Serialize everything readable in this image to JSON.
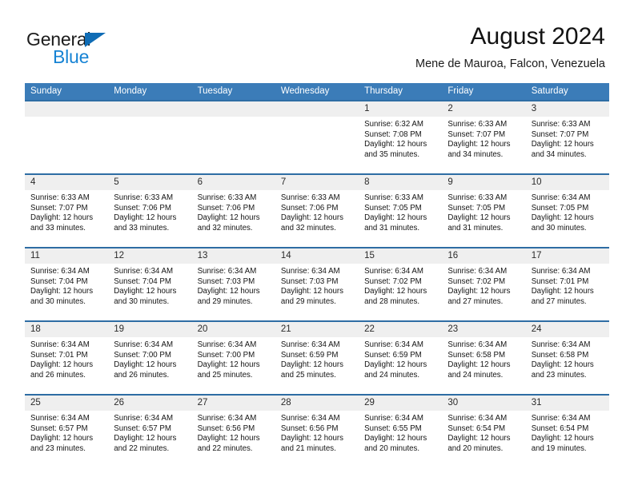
{
  "brand": {
    "name_dark": "General",
    "name_blue": "Blue",
    "accent_color": "#1683d4",
    "triangle_color": "#0f6cb5"
  },
  "header": {
    "title": "August 2024",
    "subtitle": "Mene de Mauroa, Falcon, Venezuela"
  },
  "theme": {
    "header_row_bg": "#3b7cb8",
    "row_separator": "#2e6da4",
    "date_band_bg": "#efefef"
  },
  "weekdays": [
    "Sunday",
    "Monday",
    "Tuesday",
    "Wednesday",
    "Thursday",
    "Friday",
    "Saturday"
  ],
  "weeks": [
    [
      {
        "day": "",
        "empty": true
      },
      {
        "day": "",
        "empty": true
      },
      {
        "day": "",
        "empty": true
      },
      {
        "day": "",
        "empty": true
      },
      {
        "day": "1",
        "sunrise": "Sunrise: 6:32 AM",
        "sunset": "Sunset: 7:08 PM",
        "daylight": "Daylight: 12 hours and 35 minutes."
      },
      {
        "day": "2",
        "sunrise": "Sunrise: 6:33 AM",
        "sunset": "Sunset: 7:07 PM",
        "daylight": "Daylight: 12 hours and 34 minutes."
      },
      {
        "day": "3",
        "sunrise": "Sunrise: 6:33 AM",
        "sunset": "Sunset: 7:07 PM",
        "daylight": "Daylight: 12 hours and 34 minutes."
      }
    ],
    [
      {
        "day": "4",
        "sunrise": "Sunrise: 6:33 AM",
        "sunset": "Sunset: 7:07 PM",
        "daylight": "Daylight: 12 hours and 33 minutes."
      },
      {
        "day": "5",
        "sunrise": "Sunrise: 6:33 AM",
        "sunset": "Sunset: 7:06 PM",
        "daylight": "Daylight: 12 hours and 33 minutes."
      },
      {
        "day": "6",
        "sunrise": "Sunrise: 6:33 AM",
        "sunset": "Sunset: 7:06 PM",
        "daylight": "Daylight: 12 hours and 32 minutes."
      },
      {
        "day": "7",
        "sunrise": "Sunrise: 6:33 AM",
        "sunset": "Sunset: 7:06 PM",
        "daylight": "Daylight: 12 hours and 32 minutes."
      },
      {
        "day": "8",
        "sunrise": "Sunrise: 6:33 AM",
        "sunset": "Sunset: 7:05 PM",
        "daylight": "Daylight: 12 hours and 31 minutes."
      },
      {
        "day": "9",
        "sunrise": "Sunrise: 6:33 AM",
        "sunset": "Sunset: 7:05 PM",
        "daylight": "Daylight: 12 hours and 31 minutes."
      },
      {
        "day": "10",
        "sunrise": "Sunrise: 6:34 AM",
        "sunset": "Sunset: 7:05 PM",
        "daylight": "Daylight: 12 hours and 30 minutes."
      }
    ],
    [
      {
        "day": "11",
        "sunrise": "Sunrise: 6:34 AM",
        "sunset": "Sunset: 7:04 PM",
        "daylight": "Daylight: 12 hours and 30 minutes."
      },
      {
        "day": "12",
        "sunrise": "Sunrise: 6:34 AM",
        "sunset": "Sunset: 7:04 PM",
        "daylight": "Daylight: 12 hours and 30 minutes."
      },
      {
        "day": "13",
        "sunrise": "Sunrise: 6:34 AM",
        "sunset": "Sunset: 7:03 PM",
        "daylight": "Daylight: 12 hours and 29 minutes."
      },
      {
        "day": "14",
        "sunrise": "Sunrise: 6:34 AM",
        "sunset": "Sunset: 7:03 PM",
        "daylight": "Daylight: 12 hours and 29 minutes."
      },
      {
        "day": "15",
        "sunrise": "Sunrise: 6:34 AM",
        "sunset": "Sunset: 7:02 PM",
        "daylight": "Daylight: 12 hours and 28 minutes."
      },
      {
        "day": "16",
        "sunrise": "Sunrise: 6:34 AM",
        "sunset": "Sunset: 7:02 PM",
        "daylight": "Daylight: 12 hours and 27 minutes."
      },
      {
        "day": "17",
        "sunrise": "Sunrise: 6:34 AM",
        "sunset": "Sunset: 7:01 PM",
        "daylight": "Daylight: 12 hours and 27 minutes."
      }
    ],
    [
      {
        "day": "18",
        "sunrise": "Sunrise: 6:34 AM",
        "sunset": "Sunset: 7:01 PM",
        "daylight": "Daylight: 12 hours and 26 minutes."
      },
      {
        "day": "19",
        "sunrise": "Sunrise: 6:34 AM",
        "sunset": "Sunset: 7:00 PM",
        "daylight": "Daylight: 12 hours and 26 minutes."
      },
      {
        "day": "20",
        "sunrise": "Sunrise: 6:34 AM",
        "sunset": "Sunset: 7:00 PM",
        "daylight": "Daylight: 12 hours and 25 minutes."
      },
      {
        "day": "21",
        "sunrise": "Sunrise: 6:34 AM",
        "sunset": "Sunset: 6:59 PM",
        "daylight": "Daylight: 12 hours and 25 minutes."
      },
      {
        "day": "22",
        "sunrise": "Sunrise: 6:34 AM",
        "sunset": "Sunset: 6:59 PM",
        "daylight": "Daylight: 12 hours and 24 minutes."
      },
      {
        "day": "23",
        "sunrise": "Sunrise: 6:34 AM",
        "sunset": "Sunset: 6:58 PM",
        "daylight": "Daylight: 12 hours and 24 minutes."
      },
      {
        "day": "24",
        "sunrise": "Sunrise: 6:34 AM",
        "sunset": "Sunset: 6:58 PM",
        "daylight": "Daylight: 12 hours and 23 minutes."
      }
    ],
    [
      {
        "day": "25",
        "sunrise": "Sunrise: 6:34 AM",
        "sunset": "Sunset: 6:57 PM",
        "daylight": "Daylight: 12 hours and 23 minutes."
      },
      {
        "day": "26",
        "sunrise": "Sunrise: 6:34 AM",
        "sunset": "Sunset: 6:57 PM",
        "daylight": "Daylight: 12 hours and 22 minutes."
      },
      {
        "day": "27",
        "sunrise": "Sunrise: 6:34 AM",
        "sunset": "Sunset: 6:56 PM",
        "daylight": "Daylight: 12 hours and 22 minutes."
      },
      {
        "day": "28",
        "sunrise": "Sunrise: 6:34 AM",
        "sunset": "Sunset: 6:56 PM",
        "daylight": "Daylight: 12 hours and 21 minutes."
      },
      {
        "day": "29",
        "sunrise": "Sunrise: 6:34 AM",
        "sunset": "Sunset: 6:55 PM",
        "daylight": "Daylight: 12 hours and 20 minutes."
      },
      {
        "day": "30",
        "sunrise": "Sunrise: 6:34 AM",
        "sunset": "Sunset: 6:54 PM",
        "daylight": "Daylight: 12 hours and 20 minutes."
      },
      {
        "day": "31",
        "sunrise": "Sunrise: 6:34 AM",
        "sunset": "Sunset: 6:54 PM",
        "daylight": "Daylight: 12 hours and 19 minutes."
      }
    ]
  ]
}
